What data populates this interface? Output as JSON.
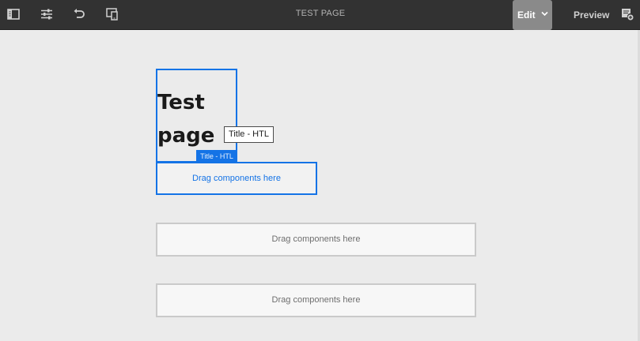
{
  "toolbar": {
    "page_title": "TEST PAGE",
    "edit_label": "Edit",
    "preview_label": "Preview",
    "icons": {
      "side_panel": "side-panel-toggle-icon",
      "page_properties": "sliders-icon",
      "undo": "undo-icon",
      "emulator": "emulator-icon",
      "mode_dropdown": "chevron-down-icon",
      "annotate": "annotate-icon"
    }
  },
  "canvas": {
    "title_component": {
      "text_line1": "Test",
      "text_line2": "page",
      "label": "Title - HTL"
    },
    "tooltip": "Title - HTL",
    "drop_zones": [
      {
        "label": "Drag components here"
      },
      {
        "label": "Drag components here"
      },
      {
        "label": "Drag components here"
      }
    ]
  },
  "colors": {
    "toolbar_bg": "#323232",
    "accent": "#1473e6",
    "canvas_bg": "#ebebeb",
    "edit_active_bg": "#8a8a8a"
  }
}
